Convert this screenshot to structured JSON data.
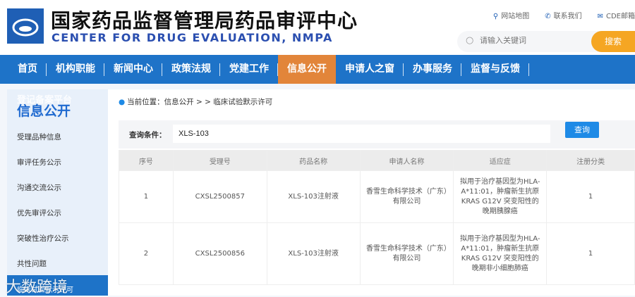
{
  "header": {
    "title_cn": "国家药品监督管理局药品审评中心",
    "title_en": "CENTER FOR DRUG EVALUATION, NMPA",
    "links": [
      {
        "icon": "map-pin-icon",
        "label": "网站地图"
      },
      {
        "icon": "phone-icon",
        "label": "联系我们"
      },
      {
        "icon": "mail-icon",
        "label": "CDE邮箱"
      }
    ],
    "search_placeholder": "请输入关键词",
    "search_button": "搜索"
  },
  "nav": [
    "首页",
    "机构职能",
    "新闻中心",
    "政策法规",
    "党建工作",
    "信息公开",
    "申请人之窗",
    "办事服务",
    "监督与反馈"
  ],
  "sidebar": {
    "ghost": "登记备案平台",
    "title": "信息公开",
    "items": [
      "受理品种信息",
      "审评任务公示",
      "沟通交流公示",
      "优先审评公示",
      "突破性治疗公示",
      "共性问题"
    ],
    "active": "临床试验默示许可"
  },
  "watermark": "大数跨境",
  "breadcrumb": "当前位置：信息公开 > > 临床试验默示许可",
  "query": {
    "label": "查询条件：",
    "value": "XLS-103",
    "button": "查询"
  },
  "table": {
    "headers": [
      "序号",
      "受理号",
      "药品名称",
      "申请人名称",
      "适应症",
      "注册分类"
    ],
    "rows": [
      [
        "1",
        "CXSL2500857",
        "XLS-103注射液",
        "香雪生命科学技术（广东）有限公司",
        "拟用于治疗基因型为HLA-A*11:01，肿瘤新生抗原KRAS G12V 突变阳性的晚期胰腺癌",
        "1"
      ],
      [
        "2",
        "CXSL2500856",
        "XLS-103注射液",
        "香雪生命科学技术（广东）有限公司",
        "拟用于治疗基因型为HLA-A*11:01，肿瘤新生抗原KRAS G12V 突变阳性的晚期非小细胞肺癌",
        "1"
      ]
    ]
  }
}
